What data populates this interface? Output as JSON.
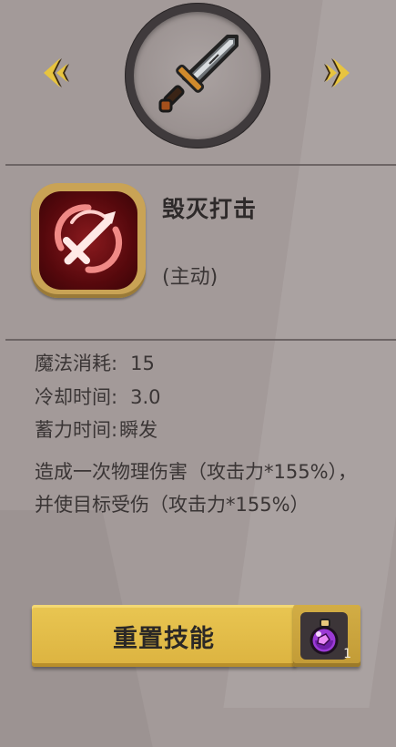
{
  "navigation": {
    "prev_icon": "chevron-left-icon",
    "next_icon": "chevron-right-icon"
  },
  "weapon": {
    "icon": "sword-icon"
  },
  "skill": {
    "icon": "crossed-swords-strike-icon",
    "name": "毁灭打击",
    "type": "(主动)"
  },
  "stats": [
    {
      "label": "魔法消耗:",
      "value": "15"
    },
    {
      "label": "冷却时间:",
      "value": "3.0"
    },
    {
      "label": "蓄力时间:",
      "value": "瞬发"
    }
  ],
  "description": "造成一次物理伤害（攻击力*155%），并使目标受伤（攻击力*155%）",
  "reset_button": {
    "label": "重置技能",
    "cost_icon": "purple-potion-icon",
    "cost_count": "1"
  },
  "colors": {
    "background": "#a39a99",
    "accent_gold": "#dcb340",
    "skill_red": "#8a1a1e",
    "frame_dark": "#3f3a3c"
  }
}
